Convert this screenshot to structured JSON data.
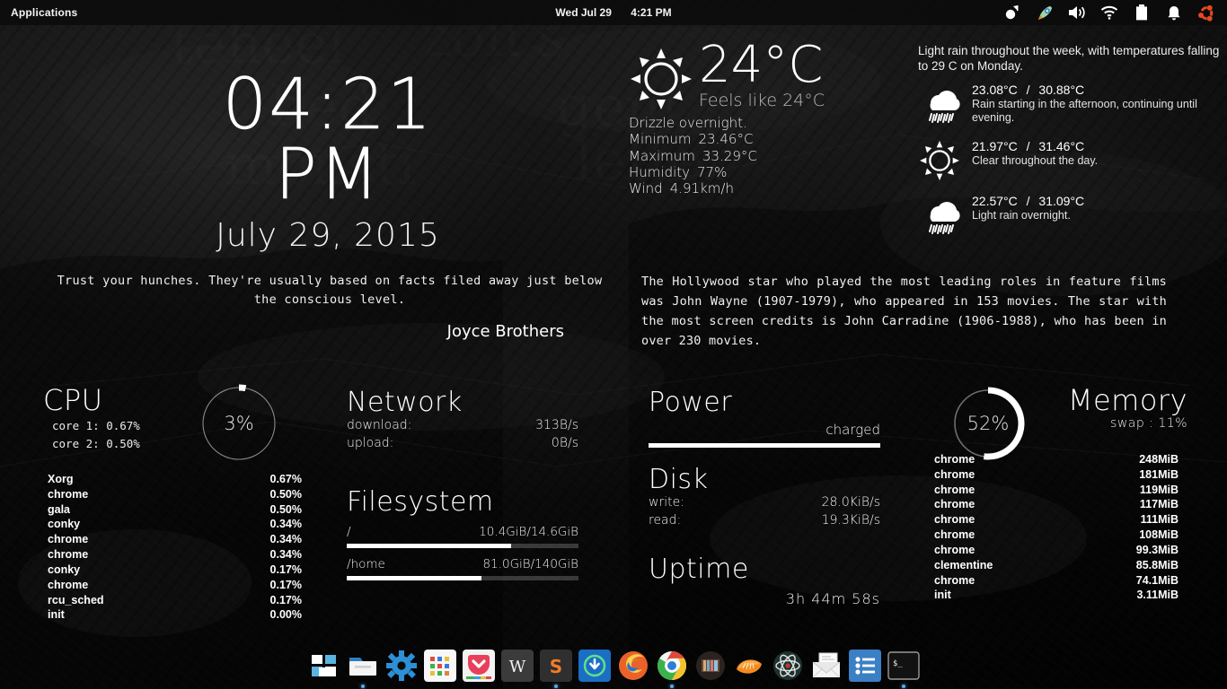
{
  "panel": {
    "applications_label": "Applications",
    "date": "Wed Jul 29",
    "time": "4:21 PM",
    "tray": [
      {
        "name": "notification-indicator-icon",
        "label": "notifications"
      },
      {
        "name": "rocket-launcher-icon",
        "label": "launcher"
      },
      {
        "name": "volume-icon",
        "label": "sound"
      },
      {
        "name": "wifi-icon",
        "label": "network"
      },
      {
        "name": "battery-icon",
        "label": "battery"
      },
      {
        "name": "bell-icon",
        "label": "alerts"
      },
      {
        "name": "ubuntu-icon",
        "label": "ubuntu"
      }
    ]
  },
  "clock": {
    "time": "04:21 PM",
    "date": "July 29, 2015"
  },
  "weather": {
    "icon": "sun-icon",
    "temperature": "24°C",
    "feels_like": "Feels like 24°C",
    "condition": "Drizzle overnight.",
    "minimum_label": "Minimum",
    "minimum_value": "23.46°C",
    "maximum_label": "Maximum",
    "maximum_value": "33.29°C",
    "humidity_label": "Humidity",
    "humidity_value": "77%",
    "wind_label": "Wind",
    "wind_value": "4.91km/h"
  },
  "forecast": {
    "summary": "Light rain throughout the week, with temperatures falling to 29 C on Monday.",
    "days": [
      {
        "icon": "rain-cloud-icon",
        "low": "23.08°C",
        "high": "30.88°C",
        "desc": "Rain starting in the afternoon, continuing until evening."
      },
      {
        "icon": "sun-icon",
        "low": "21.97°C",
        "high": "31.46°C",
        "desc": "Clear throughout the day."
      },
      {
        "icon": "rain-cloud-icon",
        "low": "22.57°C",
        "high": "31.09°C",
        "desc": "Light rain overnight."
      }
    ],
    "separator": "/"
  },
  "quote_left": {
    "text": "Trust your hunches. They're usually based on facts filed away just below the conscious level.",
    "author": "Joyce Brothers"
  },
  "quote_right": {
    "text": "The Hollywood star who played the most leading roles in feature films was John Wayne (1907-1979), who appeared in 153 movies. The star with the most screen credits is John Carradine (1906-1988), who has been in over 230 movies."
  },
  "cpu": {
    "title": "CPU",
    "ring_value": "3%",
    "ring_percent": 3,
    "core1": "core 1: 0.67%",
    "core2": "core 2: 0.50%",
    "processes": [
      {
        "name": "Xorg",
        "value": "0.67%"
      },
      {
        "name": "chrome",
        "value": "0.50%"
      },
      {
        "name": "gala",
        "value": "0.50%"
      },
      {
        "name": "conky",
        "value": "0.34%"
      },
      {
        "name": "chrome",
        "value": "0.34%"
      },
      {
        "name": "chrome",
        "value": "0.34%"
      },
      {
        "name": "conky",
        "value": "0.17%"
      },
      {
        "name": "chrome",
        "value": "0.17%"
      },
      {
        "name": "rcu_sched",
        "value": "0.17%"
      },
      {
        "name": "init",
        "value": "0.00%"
      }
    ]
  },
  "network": {
    "title": "Network",
    "download_label": "download:",
    "download_value": "313B/s",
    "upload_label": "upload:",
    "upload_value": "0B/s"
  },
  "filesystem": {
    "title": "Filesystem",
    "mounts": [
      {
        "name": "/",
        "value": "10.4GiB/14.6GiB",
        "percent": 71
      },
      {
        "name": "/home",
        "value": "81.0GiB/140GiB",
        "percent": 58
      }
    ]
  },
  "power": {
    "title": "Power",
    "state": "charged",
    "percent": 100
  },
  "disk": {
    "title": "Disk",
    "write_label": "write:",
    "write_value": "28.0KiB/s",
    "read_label": "read:",
    "read_value": "19.3KiB/s"
  },
  "uptime": {
    "title": "Uptime",
    "value": "3h 44m 58s"
  },
  "memory": {
    "title": "Memory",
    "ring_value": "52%",
    "ring_percent": 52,
    "swap": "swap : 11%",
    "processes": [
      {
        "name": "chrome",
        "value": "248MiB"
      },
      {
        "name": "chrome",
        "value": "181MiB"
      },
      {
        "name": "chrome",
        "value": "119MiB"
      },
      {
        "name": "chrome",
        "value": "117MiB"
      },
      {
        "name": "chrome",
        "value": "111MiB"
      },
      {
        "name": "chrome",
        "value": "108MiB"
      },
      {
        "name": "chrome",
        "value": "99.3MiB"
      },
      {
        "name": "clementine",
        "value": "85.8MiB"
      },
      {
        "name": "chrome",
        "value": "74.1MiB"
      },
      {
        "name": "init",
        "value": "3.11MiB"
      }
    ]
  },
  "dock": {
    "items": [
      {
        "name": "slingshot-apps-icon",
        "label": "Applications",
        "running": false
      },
      {
        "name": "files-manager-icon",
        "label": "Files",
        "running": true
      },
      {
        "name": "system-settings-icon",
        "label": "System Settings",
        "running": false
      },
      {
        "name": "app-grid-icon",
        "label": "App Grid",
        "running": false
      },
      {
        "name": "pocket-icon",
        "label": "Pocket",
        "running": false
      },
      {
        "name": "wunderlist-icon",
        "label": "Wunderlist",
        "running": false
      },
      {
        "name": "sublime-text-icon",
        "label": "Sublime Text",
        "running": true
      },
      {
        "name": "download-manager-icon",
        "label": "Downloads",
        "running": false
      },
      {
        "name": "firefox-icon",
        "label": "Firefox",
        "running": false
      },
      {
        "name": "chrome-icon",
        "label": "Google Chrome",
        "running": true
      },
      {
        "name": "calibre-icon",
        "label": "Calibre",
        "running": false
      },
      {
        "name": "clementine-icon",
        "label": "Clementine",
        "running": false
      },
      {
        "name": "atom-icon",
        "label": "Atom",
        "running": false
      },
      {
        "name": "mail-icon",
        "label": "Mail",
        "running": false
      },
      {
        "name": "todo-list-icon",
        "label": "Tasks",
        "running": false
      },
      {
        "name": "terminal-icon",
        "label": "Terminal",
        "running": true
      }
    ]
  },
  "colors": {
    "accent": "#ffffff",
    "panel_bg": "#0a0a0a",
    "muted_text": "#b9b9b9"
  }
}
